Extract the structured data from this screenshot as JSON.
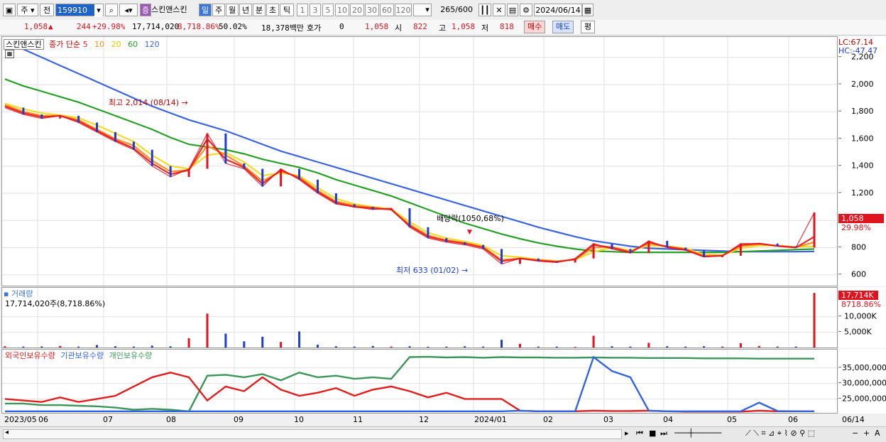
{
  "toolbar": {
    "type_select": "주",
    "market_select": "전",
    "code": "159910",
    "stock_badge": "증",
    "stock_name": "스킨앤스킨",
    "periods": [
      "일",
      "주",
      "월",
      "년",
      "분",
      "초",
      "틱"
    ],
    "intervals": [
      "1",
      "3",
      "5",
      "10",
      "20",
      "30",
      "60",
      "120"
    ],
    "count": "265",
    "count_max": "/600",
    "date": "2024/06/14"
  },
  "quote": {
    "price": "1,058",
    "change": "244",
    "change_pct": "+29.98%",
    "volume": "17,714,020",
    "volume_pct": "8,718.86%",
    "turnover": "50.02%",
    "amount": "18,378백만",
    "hoga_label": "호가",
    "hoga_value": "0",
    "price2": "1,058",
    "open_label": "시",
    "open": "822",
    "high_label": "고",
    "high": "1,058",
    "low_label": "저",
    "low": "818",
    "buy_btn": "매수",
    "sell_btn": "매도",
    "eval_btn": "평"
  },
  "price_panel": {
    "name_tag": "스킨앤스킨",
    "ma_label": "종가 단순",
    "ma_periods": [
      "5",
      "10",
      "20",
      "60",
      "120"
    ],
    "lc": "LC:67.14",
    "hc": "HC:-47.47",
    "current_price": "1,058",
    "current_pct": "29.98%",
    "high_annotation": "최고 2,014 (08/14)",
    "low_annotation": "최저 633 (01/02)",
    "dividend_annotation": "배당락(1050,68%)"
  },
  "volume_panel": {
    "title": "거래량",
    "value_text": "17,714,020주(8,718.86%)",
    "current_tag": "17,714K",
    "current_pct": "8718.86%"
  },
  "holdings_panel": {
    "labels": [
      "외국인보유수량",
      "기관보유수량",
      "개인보유수량"
    ]
  },
  "colors": {
    "up": "#e0141e",
    "down": "#1e3cd2",
    "ma5": "#e62828",
    "ma10": "#ff8c1e",
    "ma20": "#f0dc28",
    "ma60": "#28a028",
    "ma120": "#3c64dc",
    "foreign": "#e01e1e",
    "institution": "#3264dc",
    "individual": "#3c965a"
  },
  "chart_data": [
    {
      "type": "line",
      "title": "스킨앤스킨",
      "x_ticks": [
        "2023/05",
        "06",
        "07",
        "08",
        "09",
        "10",
        "11",
        "12",
        "2024/01",
        "02",
        "03",
        "04",
        "05",
        "06",
        "06/14"
      ],
      "y_ticks": [
        600,
        800,
        1000,
        1200,
        1400,
        1600,
        1800,
        2000,
        2200
      ],
      "ylim": [
        520,
        2350
      ],
      "x_index": [
        0,
        6,
        12,
        18,
        24,
        30,
        36,
        42,
        48,
        54,
        60,
        66,
        72,
        78,
        84,
        90,
        96,
        102,
        108,
        114,
        120,
        126,
        132,
        138,
        144,
        150,
        156,
        162,
        168,
        174,
        180,
        186,
        192,
        198,
        204,
        210,
        216,
        222,
        228,
        234,
        240,
        246,
        252,
        258,
        264
      ],
      "series": [
        {
          "name": "종가",
          "values": [
            1830,
            1780,
            1750,
            1770,
            1720,
            1650,
            1580,
            1520,
            1400,
            1320,
            1380,
            1640,
            1420,
            1380,
            1250,
            1380,
            1300,
            1200,
            1120,
            1100,
            1080,
            1090,
            950,
            870,
            840,
            820,
            790,
            680,
            720,
            700,
            690,
            720,
            830,
            790,
            760,
            850,
            800,
            780,
            730,
            740,
            830,
            830,
            810,
            800,
            1058
          ]
        },
        {
          "name": "5",
          "values": [
            1840,
            1790,
            1760,
            1770,
            1730,
            1660,
            1590,
            1530,
            1420,
            1340,
            1370,
            1600,
            1450,
            1390,
            1270,
            1370,
            1310,
            1210,
            1130,
            1100,
            1090,
            1080,
            960,
            880,
            850,
            830,
            800,
            700,
            720,
            705,
            695,
            715,
            820,
            800,
            765,
            840,
            805,
            785,
            735,
            740,
            820,
            830,
            812,
            800,
            880
          ]
        },
        {
          "name": "10",
          "values": [
            1850,
            1800,
            1770,
            1770,
            1740,
            1670,
            1600,
            1550,
            1440,
            1360,
            1370,
            1550,
            1480,
            1400,
            1290,
            1360,
            1320,
            1220,
            1140,
            1110,
            1095,
            1080,
            970,
            890,
            855,
            835,
            805,
            710,
            720,
            708,
            698,
            712,
            800,
            805,
            770,
            830,
            810,
            790,
            740,
            742,
            810,
            825,
            815,
            802,
            840
          ]
        },
        {
          "name": "20",
          "values": [
            1860,
            1820,
            1790,
            1775,
            1755,
            1700,
            1640,
            1580,
            1480,
            1400,
            1380,
            1480,
            1500,
            1430,
            1330,
            1350,
            1330,
            1240,
            1160,
            1120,
            1100,
            1085,
            990,
            910,
            870,
            845,
            815,
            740,
            730,
            712,
            702,
            710,
            770,
            800,
            780,
            815,
            810,
            795,
            750,
            745,
            795,
            815,
            815,
            805,
            810
          ]
        },
        {
          "name": "60",
          "values": [
            2040,
            1990,
            1950,
            1910,
            1870,
            1820,
            1770,
            1720,
            1670,
            1610,
            1560,
            1540,
            1520,
            1490,
            1450,
            1420,
            1390,
            1350,
            1300,
            1260,
            1220,
            1180,
            1130,
            1080,
            1030,
            980,
            940,
            900,
            865,
            835,
            810,
            790,
            775,
            770,
            765,
            765,
            765,
            765,
            765,
            765,
            770,
            775,
            780,
            785,
            790
          ]
        },
        {
          "name": "120",
          "values": [
            2330,
            2260,
            2200,
            2140,
            2080,
            2020,
            1960,
            1900,
            1840,
            1790,
            1740,
            1700,
            1660,
            1610,
            1560,
            1510,
            1470,
            1430,
            1390,
            1350,
            1310,
            1270,
            1230,
            1190,
            1150,
            1110,
            1070,
            1030,
            990,
            950,
            915,
            880,
            850,
            830,
            810,
            795,
            790,
            785,
            780,
            775,
            770,
            770,
            770,
            770,
            772
          ]
        }
      ]
    },
    {
      "type": "bar",
      "title": "거래량",
      "x_index": [
        0,
        6,
        12,
        18,
        24,
        30,
        36,
        42,
        48,
        54,
        60,
        66,
        72,
        78,
        84,
        90,
        96,
        102,
        108,
        114,
        120,
        126,
        132,
        138,
        144,
        150,
        156,
        162,
        168,
        174,
        180,
        186,
        192,
        198,
        204,
        210,
        216,
        222,
        228,
        234,
        240,
        246,
        252,
        258,
        264
      ],
      "y_ticks": [
        5000,
        10000
      ],
      "y_tick_labels": [
        "5,000K",
        "10,000K"
      ],
      "ylim": [
        0,
        18000
      ],
      "series": [
        {
          "name": "거래량",
          "unit": "K",
          "values": [
            400,
            300,
            350,
            500,
            300,
            800,
            400,
            300,
            600,
            400,
            3000,
            11000,
            4500,
            2000,
            3500,
            1800,
            5200,
            900,
            400,
            300,
            500,
            300,
            400,
            250,
            300,
            400,
            300,
            2500,
            1200,
            300,
            300,
            200,
            3800,
            400,
            300,
            1500,
            400,
            300,
            400,
            300,
            1400,
            500,
            300,
            300,
            17714
          ]
        }
      ]
    },
    {
      "type": "line",
      "title": "보유수량",
      "x_index": [
        0,
        6,
        12,
        18,
        24,
        30,
        36,
        42,
        48,
        54,
        60,
        66,
        72,
        78,
        84,
        90,
        96,
        102,
        108,
        114,
        120,
        126,
        132,
        138,
        144,
        150,
        156,
        162,
        168,
        174,
        180,
        186,
        192,
        198,
        204,
        210,
        216,
        222,
        228,
        234,
        240,
        246,
        252,
        258,
        264
      ],
      "y_ticks": [
        25000000,
        30000000,
        35000000
      ],
      "y_tick_labels": [
        "25,000,000",
        "30,000,000",
        "35,000,000"
      ],
      "ylim": [
        20500000,
        40000000
      ],
      "series": [
        {
          "name": "외국인보유수량",
          "values": [
            25000000,
            24500000,
            24000000,
            25500000,
            24000000,
            25000000,
            26000000,
            29000000,
            32000000,
            33500000,
            32000000,
            24500000,
            29000000,
            27500000,
            32000000,
            28000000,
            26000000,
            27000000,
            28500000,
            26000000,
            28000000,
            29000000,
            27500000,
            25500000,
            27000000,
            25000000,
            25000000,
            25000000,
            21200000,
            21000000,
            21000000,
            21000000,
            21200000,
            21100000,
            21100000,
            21200000,
            21000000,
            20900000,
            20900000,
            20900000,
            20900000,
            21200000,
            21000000,
            21000000,
            21000000
          ]
        },
        {
          "name": "기관보유수량",
          "values": [
            21000000,
            21000000,
            21000000,
            21000000,
            21000000,
            21000000,
            21000000,
            21000000,
            21000000,
            21000000,
            21000000,
            21000000,
            21000000,
            21000000,
            21000000,
            21000000,
            21000000,
            21000000,
            21000000,
            21000000,
            21000000,
            21000000,
            21000000,
            21000000,
            21000000,
            21000000,
            21000000,
            21000000,
            21200000,
            21000000,
            21000000,
            21000000,
            38500000,
            34000000,
            32000000,
            21200000,
            21000000,
            21000000,
            21000000,
            21000000,
            21000000,
            23800000,
            21100000,
            21000000,
            21000000
          ]
        },
        {
          "name": "개인보유수량",
          "values": [
            23500000,
            23500000,
            23000000,
            23000000,
            22800000,
            22600000,
            22200000,
            21500000,
            21800000,
            21500000,
            21000000,
            32500000,
            32800000,
            32000000,
            33000000,
            31000000,
            33500000,
            32000000,
            32500000,
            31500000,
            32000000,
            31500000,
            38500000,
            38600000,
            38400000,
            38500000,
            38300000,
            38500000,
            38400000,
            38400000,
            38300000,
            38300000,
            38400000,
            38300000,
            38300000,
            38200000,
            38200000,
            38200000,
            38100000,
            38100000,
            38100000,
            38000000,
            38000000,
            38000000,
            38000000
          ]
        }
      ]
    }
  ]
}
